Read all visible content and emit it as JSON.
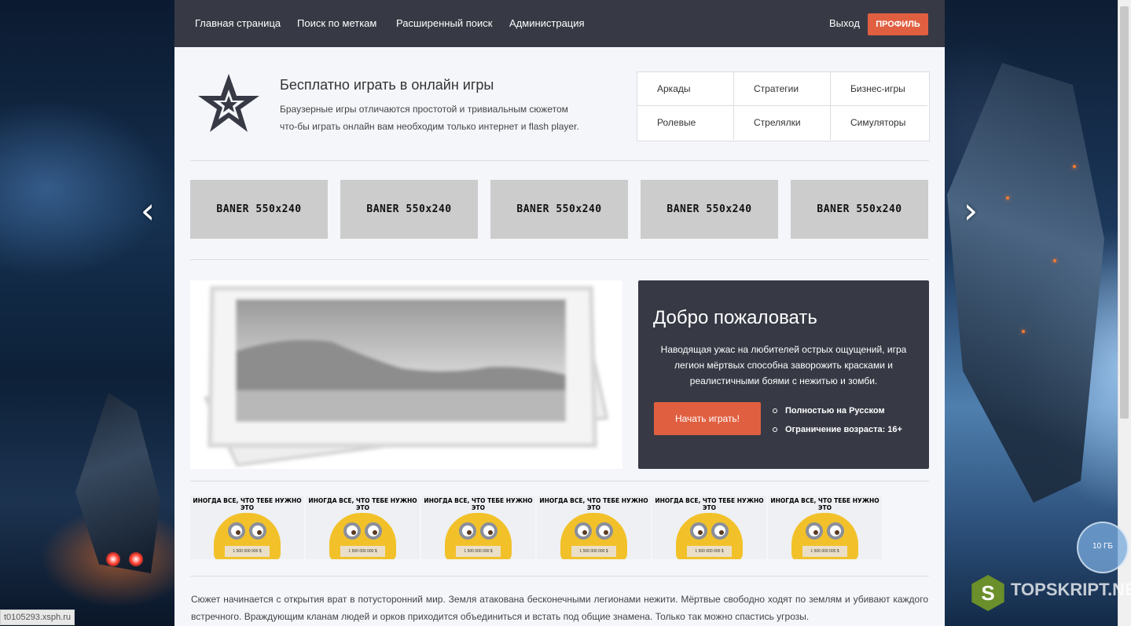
{
  "nav": {
    "items": [
      "Главная страница",
      "Поиск по меткам",
      "Расширенный поиск",
      "Администрация"
    ],
    "logout": "Выход",
    "profile": "ПРОФИЛЬ"
  },
  "header": {
    "title": "Бесплатно играть в онлайн игры",
    "desc_line1": "Браузерные игры отличаются простотой и тривиальным сюжетом",
    "desc_line2": "что-бы играть онлайн вам необходим только интернет и flash player."
  },
  "categories": [
    "Аркады",
    "Стратегии",
    "Бизнес-игры",
    "Ролевые",
    "Стрелялки",
    "Симуляторы"
  ],
  "banners": [
    "BANER 550x240",
    "BANER 550x240",
    "BANER 550x240",
    "BANER 550x240",
    "BANER 550x240"
  ],
  "welcome": {
    "title": "Добро пожаловать",
    "desc": "Наводящая ужас на любителей острых ощущений, игра легион мёртвых способна заворожить красками и реалистичными боями с нежитью и зомби.",
    "button": "Начать играть!",
    "features": [
      "Полностью на Русском",
      "Ограничение возраста: 16+"
    ]
  },
  "thumbnails": {
    "caption": "ИНОГДА ВСЕ, ЧТО ТЕБЕ НУЖНО ЭТО",
    "sign": "1 500 000 000 $",
    "count": 6
  },
  "story": "Сюжет начинается с открытия врат в потусторонний мир. Земля атакована бесконечными легионами нежити. Мёртвые свободно ходят по землям и убивают каждого встречного. Враждующим кланам людей и орков приходится объединиться и встать под общие знамена. Только так можно спастись угрозы.",
  "overlay": {
    "bubble": "10 ГБ",
    "site_logo": "S",
    "site_name": "TOPSKRIPT.NET",
    "status_url": "t0105293.xsph.ru"
  },
  "colors": {
    "nav_bg": "#373a45",
    "accent": "#e15f41",
    "page_bg": "#f5f6fa"
  },
  "icons": {
    "slider_prev": "chevron-left-icon",
    "slider_next": "chevron-right-icon",
    "header": "star-icon"
  }
}
